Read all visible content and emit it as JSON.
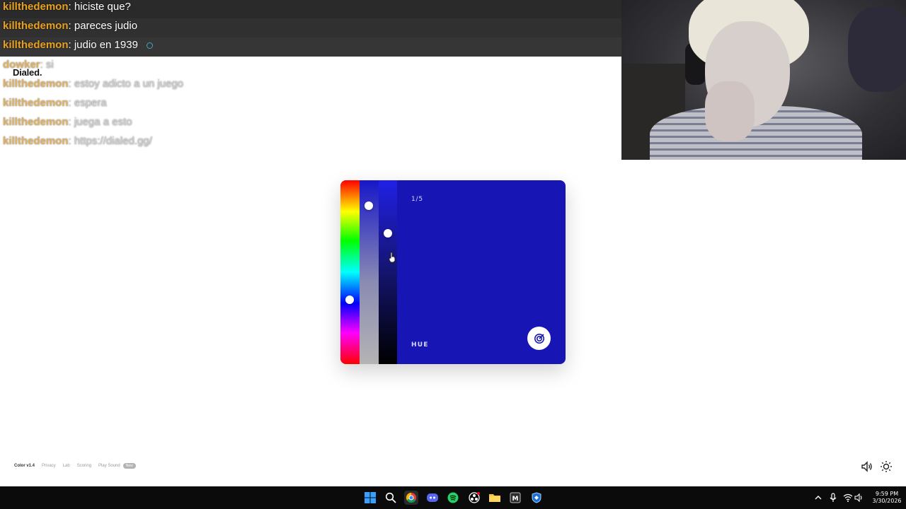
{
  "chat": {
    "messages": [
      {
        "user": "killthedemon",
        "text": ": hiciste que?"
      },
      {
        "user": "killthedemon",
        "text": ": pareces judio"
      },
      {
        "user": "killthedemon",
        "text": ": judio en 1939"
      },
      {
        "user": "dowker",
        "text": ": si"
      },
      {
        "user": "killthedemon",
        "text": ": estoy adicto a un juego"
      },
      {
        "user": "killthedemon",
        "text": ": espera"
      },
      {
        "user": "killthedemon",
        "text": ": juega a esto"
      },
      {
        "user": "killthedemon",
        "text": ": https://dialed.gg/"
      }
    ],
    "colors": {
      "user": "#e8a021",
      "user_alt": "#8ad46b"
    }
  },
  "app": {
    "brand": "Dialed.",
    "progress": "1/5",
    "mode_label": "HUE",
    "current_color": "#1716b4",
    "sliders": {
      "hue_level": 0.65,
      "saturation_level": 0.14,
      "brightness_level": 0.29
    },
    "submit_icon": "target-icon"
  },
  "footer": {
    "version": "Color v1.4",
    "links": [
      "Privacy",
      "Lab",
      "Scoring",
      "Play Sound"
    ],
    "badge": "New",
    "sound_icon": "speaker-icon",
    "theme_icon": "sun-icon"
  },
  "taskbar": {
    "icons": [
      "windows-start-icon",
      "search-icon",
      "chrome-icon",
      "discord-icon",
      "spotify-icon",
      "obs-icon",
      "file-explorer-icon",
      "app-icon",
      "game-launcher-icon"
    ],
    "clock": {
      "time": "9:59 PM",
      "date": "3/30/2026"
    }
  }
}
